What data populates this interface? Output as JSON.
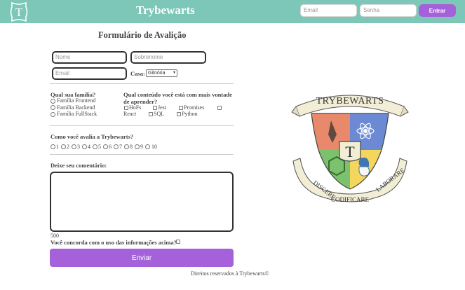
{
  "header": {
    "logo_letter": "T",
    "brand": "Trybewarts",
    "email_placeholder": "Email",
    "password_placeholder": "Senha",
    "login_label": "Entrar"
  },
  "form": {
    "title": "Formulário de Avalição",
    "name_placeholder": "Nome",
    "lastname_placeholder": "Sobrenome",
    "email_placeholder": "Email",
    "house_label": "Casa:",
    "house_selected": "Gitnória",
    "family_label": "Qual sua família?",
    "families": [
      "Família Frontend",
      "Família Backend",
      "Família FullStack"
    ],
    "content_label_1": "Qual conteúdo você está com mais vontade",
    "content_label_2": "de aprender?",
    "contents_row1": [
      "HoFs",
      "Jest",
      "Promises"
    ],
    "content_react": "React",
    "content_sql": "SQL",
    "content_python": "Python",
    "rate_label": "Como você avalia a Trybewarts?",
    "rates": [
      "1",
      "2",
      "3",
      "4",
      "5",
      "6",
      "7",
      "8",
      "9",
      "10"
    ],
    "comment_label": "Deixe seu comentário:",
    "counter": "500",
    "agreement_label": "Você concorda com o uso das informações acima?",
    "submit_label": "Enviar"
  },
  "crest": {
    "banner": "TRYBEWARTS",
    "center_letter": "T",
    "motto_left": "DISCERE",
    "motto_center": "CODIFICARE",
    "motto_right": "LABORARE"
  },
  "footer": {
    "text": "Direitos reservados à Trybewarts©"
  },
  "colors": {
    "header_bg": "#7cc7b8",
    "accent": "#a561d9"
  }
}
